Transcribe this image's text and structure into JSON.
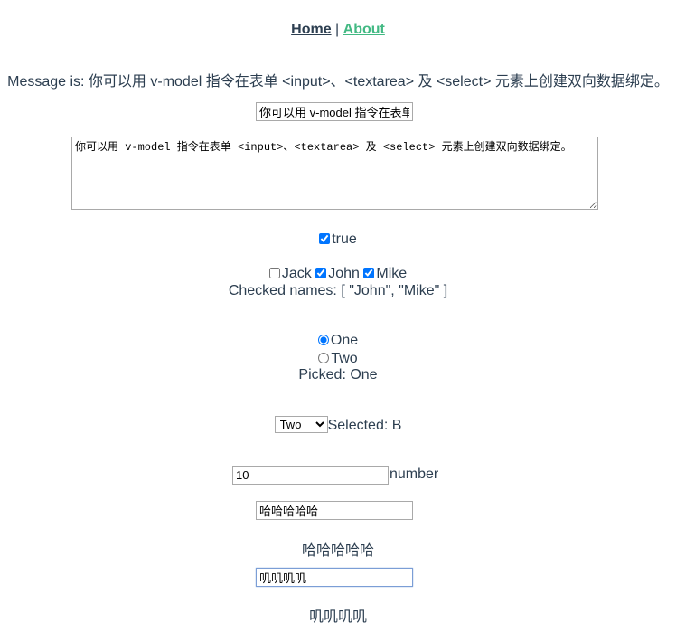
{
  "nav": {
    "home": "Home",
    "sep": "|",
    "about": "About"
  },
  "message_text": "Message is: 你可以用 v-model 指令在表单 <input>、<textarea> 及 <select> 元素上创建双向数据绑定。",
  "message_input_value": "你可以用 v-model 指令在表单 <input>、<textarea> 及 <select> 元素上创建双向数据绑定。",
  "textarea_value": "你可以用 v-model 指令在表单 <input>、<textarea> 及 <select> 元素上创建双向数据绑定。",
  "toggle": {
    "checked": true,
    "label": "true"
  },
  "names": [
    {
      "label": "Jack",
      "checked": false
    },
    {
      "label": "John",
      "checked": true
    },
    {
      "label": "Mike",
      "checked": true
    }
  ],
  "checked_names": "Checked names: [ \"John\", \"Mike\" ]",
  "radios": [
    {
      "label": "One",
      "checked": true
    },
    {
      "label": "Two",
      "checked": false
    }
  ],
  "picked": "Picked: One",
  "select": {
    "value": "Two",
    "selected_text": "Selected: B"
  },
  "number": {
    "value": "10",
    "type_label": "number"
  },
  "lazy": {
    "value": "哈哈哈哈哈",
    "output": "哈哈哈哈哈"
  },
  "trim": {
    "value": "叽叽叽叽",
    "output": "叽叽叽叽"
  }
}
